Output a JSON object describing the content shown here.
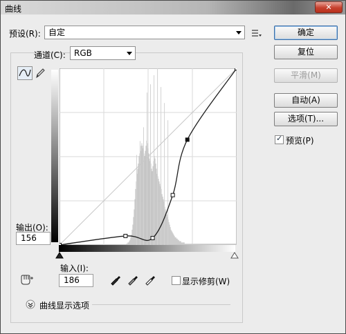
{
  "window": {
    "title": "曲线",
    "close_glyph": "✕"
  },
  "preset": {
    "label": "预设(R):",
    "value": "自定"
  },
  "channel": {
    "label": "通道(C):",
    "value": "RGB"
  },
  "buttons": {
    "ok": "确定",
    "reset": "复位",
    "smooth": "平滑(M)",
    "auto": "自动(A)",
    "options": "选项(T)..."
  },
  "preview": {
    "label": "预览(P)",
    "checked": true
  },
  "output": {
    "label": "输出(O):",
    "value": "156"
  },
  "input": {
    "label": "输入(I):",
    "value": "186"
  },
  "show_clipping": {
    "label": "显示修剪(W)",
    "checked": false
  },
  "curve_display_options": {
    "label": "曲线显示选项"
  },
  "icons": {
    "curve_tool": "curve-point-icon",
    "pencil_tool": "pencil-icon",
    "preset_menu": "preset-options-icon",
    "hand_tool": "on-image-adjust-icon",
    "black_eyedropper": "black-eyedropper-icon",
    "gray_eyedropper": "gray-eyedropper-icon",
    "white_eyedropper": "white-eyedropper-icon",
    "expand": "expand-chevron-icon"
  },
  "chart_data": {
    "type": "line",
    "title": "",
    "xlabel": "输入",
    "ylabel": "输出",
    "xlim": [
      0,
      255
    ],
    "ylim": [
      0,
      255
    ],
    "grid": true,
    "curve_points": [
      {
        "x": 0,
        "y": 0
      },
      {
        "x": 95,
        "y": 13
      },
      {
        "x": 134,
        "y": 10
      },
      {
        "x": 163,
        "y": 72
      },
      {
        "x": 184,
        "y": 152
      },
      {
        "x": 255,
        "y": 255
      }
    ],
    "histogram": [
      0,
      0,
      0,
      0,
      0,
      0,
      0,
      0,
      0,
      0,
      0,
      0,
      0,
      0,
      0,
      0,
      0,
      0,
      0,
      0,
      0,
      0,
      0,
      0,
      0,
      0,
      0,
      0,
      0,
      0,
      0,
      0,
      0,
      0,
      0,
      0,
      0,
      0,
      0,
      0,
      0,
      0,
      0,
      0,
      0,
      0,
      0,
      0,
      0,
      0,
      0,
      0,
      0,
      0,
      0,
      0,
      0,
      0,
      0,
      0,
      0,
      0,
      0,
      0,
      0,
      0,
      0,
      0,
      0,
      0,
      0,
      0,
      0,
      0,
      0,
      0,
      0,
      0,
      0,
      0,
      0,
      0,
      0,
      0,
      0,
      0,
      0,
      0,
      0,
      0,
      0,
      0,
      0,
      0,
      0,
      0,
      1,
      1,
      2,
      2,
      3,
      4,
      6,
      8,
      12,
      16,
      22,
      28,
      36,
      44,
      50,
      56,
      60,
      64,
      70,
      72,
      74,
      78,
      80,
      78,
      76,
      72,
      70,
      74,
      78,
      82,
      80,
      76,
      72,
      68,
      66,
      64,
      60,
      58,
      62,
      66,
      70,
      68,
      64,
      60,
      56,
      54,
      52,
      50,
      48,
      46,
      44,
      40,
      38,
      36,
      34,
      30,
      28,
      26,
      24,
      22,
      20,
      18,
      16,
      14,
      12,
      11,
      10,
      9,
      8,
      7,
      6,
      6,
      5,
      5,
      4,
      4,
      3,
      3,
      3,
      2,
      2,
      2,
      2,
      2,
      1,
      1,
      1,
      1,
      1,
      1,
      1,
      1,
      1,
      1,
      1,
      1,
      1,
      1,
      1,
      1,
      1,
      1,
      1,
      1,
      1,
      1,
      1,
      1,
      1,
      1,
      1,
      1,
      1,
      1,
      1,
      1,
      1,
      1,
      1,
      1,
      1,
      1,
      1,
      1,
      1,
      1,
      1,
      1,
      1,
      1,
      1,
      1,
      1,
      1,
      1,
      1,
      1,
      1,
      1,
      1,
      1,
      1,
      1,
      1,
      1,
      1,
      1,
      1,
      1,
      1,
      1,
      1,
      1,
      1,
      1,
      1,
      1,
      1,
      1,
      1
    ],
    "spikes": [
      {
        "x": 126,
        "y": 220
      },
      {
        "x": 131,
        "y": 232
      },
      {
        "x": 136,
        "y": 245
      },
      {
        "x": 141,
        "y": 255
      },
      {
        "x": 146,
        "y": 228
      },
      {
        "x": 151,
        "y": 205
      },
      {
        "x": 156,
        "y": 180
      },
      {
        "x": 111,
        "y": 130
      },
      {
        "x": 116,
        "y": 150
      },
      {
        "x": 121,
        "y": 170
      }
    ]
  }
}
